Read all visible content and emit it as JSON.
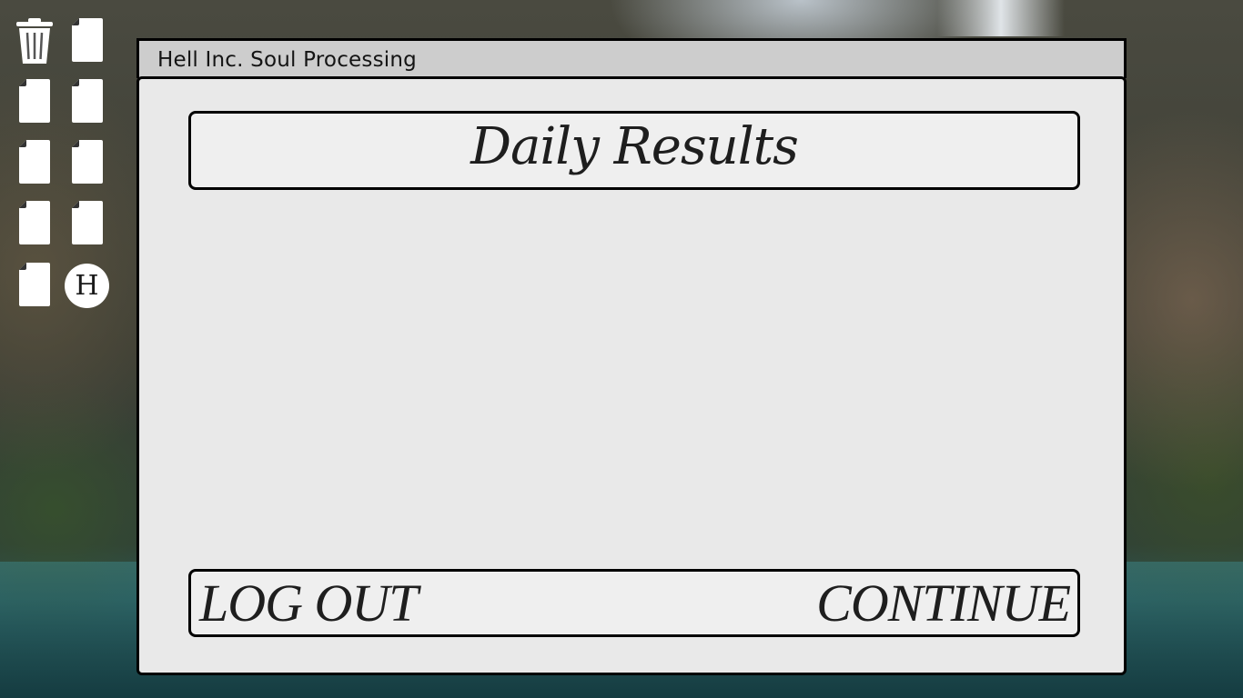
{
  "desktop": {
    "icons": [
      {
        "name": "trash-icon"
      },
      {
        "name": "file-icon"
      },
      {
        "name": "file-icon"
      },
      {
        "name": "file-icon"
      },
      {
        "name": "file-icon"
      },
      {
        "name": "file-icon"
      },
      {
        "name": "file-icon"
      },
      {
        "name": "file-icon"
      },
      {
        "name": "file-icon"
      },
      {
        "name": "hell-inc-logo-icon",
        "label": "H"
      }
    ]
  },
  "window": {
    "title": "Hell Inc. Soul Processing",
    "heading": "Daily Results",
    "actions": {
      "logout_label": "LOG OUT",
      "continue_label": "CONTINUE"
    }
  },
  "colors": {
    "window_bg": "#e9e9e9",
    "titlebar_bg": "#cdcdcd",
    "border": "#000000",
    "text": "#1e1e1e"
  }
}
